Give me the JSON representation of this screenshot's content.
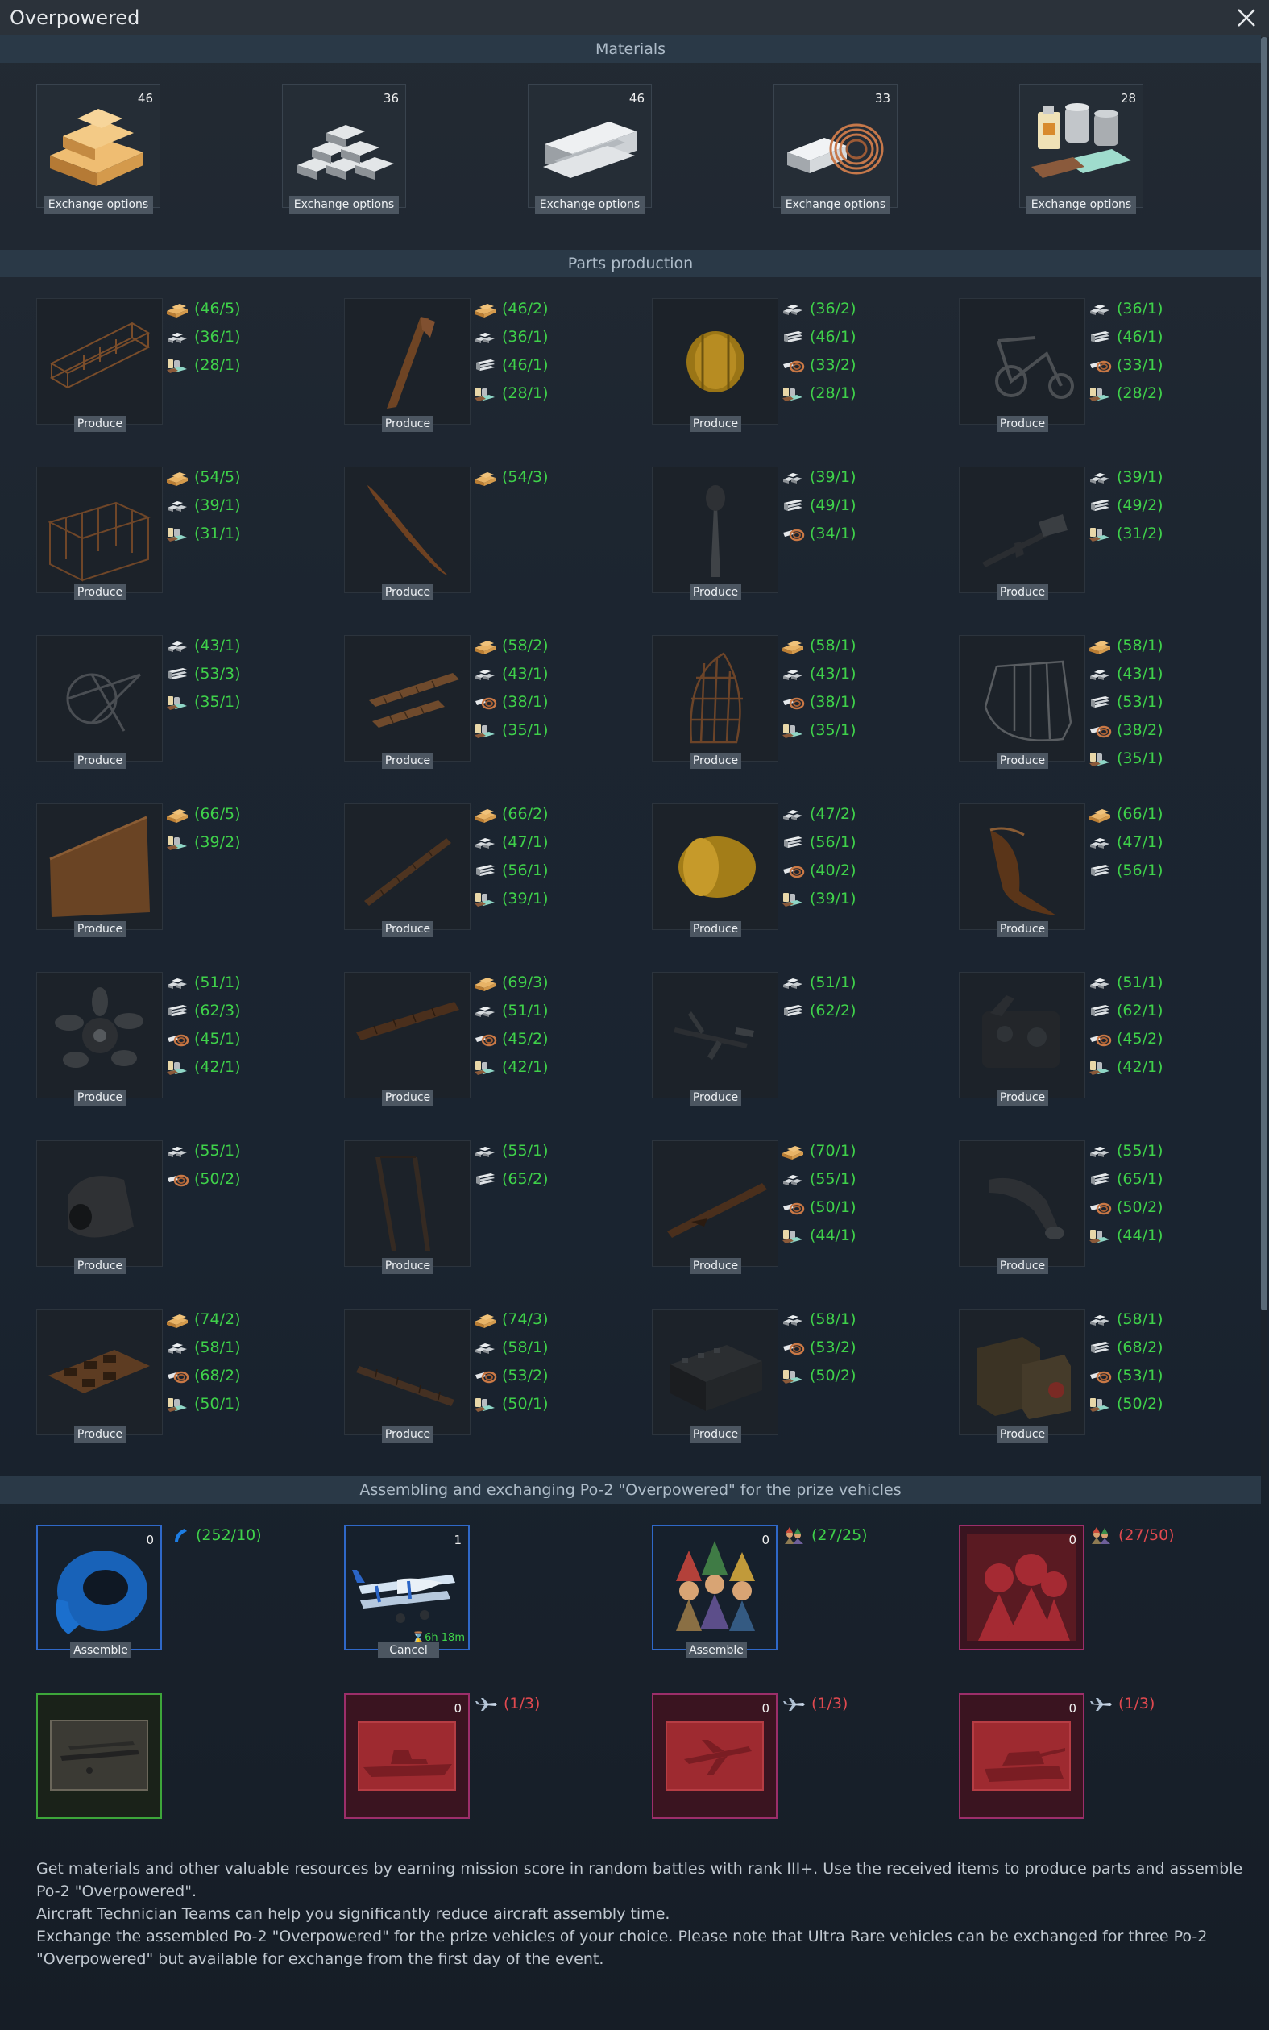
{
  "window": {
    "title": "Overpowered"
  },
  "sections": {
    "materials": "Materials",
    "parts": "Parts production",
    "assembly": "Assembling and exchanging Po-2 \"Overpowered\" for the prize vehicles"
  },
  "materials": [
    {
      "name": "wood",
      "count": "46",
      "button": "Exchange options"
    },
    {
      "name": "iron-ingots",
      "count": "36",
      "button": "Exchange options"
    },
    {
      "name": "steel-beams",
      "count": "46",
      "button": "Exchange options"
    },
    {
      "name": "aluminum-copper-wire",
      "count": "33",
      "button": "Exchange options"
    },
    {
      "name": "paints-glass",
      "count": "28",
      "button": "Exchange options"
    }
  ],
  "parts_button": "Produce",
  "parts": [
    {
      "icon": "fuselage-frame-icon",
      "reqs": [
        [
          "wood",
          "(46/5)"
        ],
        [
          "iron",
          "(36/1)"
        ],
        [
          "paint",
          "(28/1)"
        ]
      ]
    },
    {
      "icon": "strut-icon",
      "reqs": [
        [
          "wood",
          "(46/2)"
        ],
        [
          "iron",
          "(36/1)"
        ],
        [
          "steel",
          "(46/1)"
        ],
        [
          "paint",
          "(28/1)"
        ]
      ]
    },
    {
      "icon": "fuel-tank-icon",
      "reqs": [
        [
          "iron",
          "(36/2)"
        ],
        [
          "steel",
          "(46/1)"
        ],
        [
          "wire",
          "(33/2)"
        ],
        [
          "paint",
          "(28/1)"
        ]
      ]
    },
    {
      "icon": "landing-gear-icon",
      "reqs": [
        [
          "iron",
          "(36/1)"
        ],
        [
          "steel",
          "(46/1)"
        ],
        [
          "wire",
          "(33/1)"
        ],
        [
          "paint",
          "(28/2)"
        ]
      ]
    },
    {
      "icon": "cabin-frame-icon",
      "reqs": [
        [
          "wood",
          "(54/5)"
        ],
        [
          "iron",
          "(39/1)"
        ],
        [
          "paint",
          "(31/1)"
        ]
      ]
    },
    {
      "icon": "propeller-icon",
      "reqs": [
        [
          "wood",
          "(54/3)"
        ]
      ]
    },
    {
      "icon": "control-stick-icon",
      "reqs": [
        [
          "iron",
          "(39/1)"
        ],
        [
          "steel",
          "(49/1)"
        ],
        [
          "wire",
          "(34/1)"
        ]
      ]
    },
    {
      "icon": "machine-gun-icon",
      "reqs": [
        [
          "iron",
          "(39/1)"
        ],
        [
          "steel",
          "(49/2)"
        ],
        [
          "paint",
          "(31/2)"
        ]
      ]
    },
    {
      "icon": "mount-frame-icon",
      "reqs": [
        [
          "iron",
          "(43/1)"
        ],
        [
          "steel",
          "(53/3)"
        ],
        [
          "paint",
          "(35/1)"
        ]
      ]
    },
    {
      "icon": "wing-ribs-icon",
      "reqs": [
        [
          "wood",
          "(58/2)"
        ],
        [
          "iron",
          "(43/1)"
        ],
        [
          "wire",
          "(38/1)"
        ],
        [
          "paint",
          "(35/1)"
        ]
      ]
    },
    {
      "icon": "rudder-frame-icon",
      "reqs": [
        [
          "wood",
          "(58/1)"
        ],
        [
          "iron",
          "(43/1)"
        ],
        [
          "wire",
          "(38/1)"
        ],
        [
          "paint",
          "(35/1)"
        ]
      ]
    },
    {
      "icon": "seat-frame-icon",
      "reqs": [
        [
          "wood",
          "(58/1)"
        ],
        [
          "iron",
          "(43/1)"
        ],
        [
          "steel",
          "(53/1)"
        ],
        [
          "wire",
          "(38/2)"
        ],
        [
          "paint",
          "(35/1)"
        ]
      ]
    },
    {
      "icon": "wing-panel-icon",
      "reqs": [
        [
          "wood",
          "(66/5)"
        ],
        [
          "paint",
          "(39/2)"
        ]
      ]
    },
    {
      "icon": "wing-spar-icon",
      "reqs": [
        [
          "wood",
          "(66/2)"
        ],
        [
          "iron",
          "(47/1)"
        ],
        [
          "steel",
          "(56/1)"
        ],
        [
          "paint",
          "(39/1)"
        ]
      ]
    },
    {
      "icon": "tank-drum-icon",
      "reqs": [
        [
          "iron",
          "(47/2)"
        ],
        [
          "steel",
          "(56/1)"
        ],
        [
          "wire",
          "(40/2)"
        ],
        [
          "paint",
          "(39/1)"
        ]
      ]
    },
    {
      "icon": "exhaust-pipe-icon",
      "reqs": [
        [
          "wood",
          "(66/1)"
        ],
        [
          "iron",
          "(47/1)"
        ],
        [
          "steel",
          "(56/1)"
        ]
      ]
    },
    {
      "icon": "radial-engine-icon",
      "reqs": [
        [
          "iron",
          "(51/1)"
        ],
        [
          "steel",
          "(62/3)"
        ],
        [
          "wire",
          "(45/1)"
        ],
        [
          "paint",
          "(42/1)"
        ]
      ]
    },
    {
      "icon": "upper-wing-icon",
      "reqs": [
        [
          "wood",
          "(69/3)"
        ],
        [
          "iron",
          "(51/1)"
        ],
        [
          "wire",
          "(45/2)"
        ],
        [
          "paint",
          "(42/1)"
        ]
      ]
    },
    {
      "icon": "tail-assembly-icon",
      "reqs": [
        [
          "iron",
          "(51/1)"
        ],
        [
          "steel",
          "(62/2)"
        ]
      ]
    },
    {
      "icon": "instrument-panel-icon",
      "reqs": [
        [
          "iron",
          "(51/1)"
        ],
        [
          "steel",
          "(62/1)"
        ],
        [
          "wire",
          "(45/2)"
        ],
        [
          "paint",
          "(42/1)"
        ]
      ]
    },
    {
      "icon": "engine-cowling-icon",
      "reqs": [
        [
          "iron",
          "(55/1)"
        ],
        [
          "wire",
          "(50/2)"
        ]
      ]
    },
    {
      "icon": "wing-struts-icon",
      "reqs": [
        [
          "iron",
          "(55/1)"
        ],
        [
          "steel",
          "(65/2)"
        ]
      ]
    },
    {
      "icon": "lower-wing-icon",
      "reqs": [
        [
          "wood",
          "(70/1)"
        ],
        [
          "iron",
          "(55/1)"
        ],
        [
          "wire",
          "(50/1)"
        ],
        [
          "paint",
          "(44/1)"
        ]
      ]
    },
    {
      "icon": "intake-pipe-icon",
      "reqs": [
        [
          "iron",
          "(55/1)"
        ],
        [
          "steel",
          "(65/1)"
        ],
        [
          "wire",
          "(50/2)"
        ],
        [
          "paint",
          "(44/1)"
        ]
      ]
    },
    {
      "icon": "seat-box-icon",
      "reqs": [
        [
          "wood",
          "(74/2)"
        ],
        [
          "iron",
          "(58/1)"
        ],
        [
          "wire",
          "(68/2)"
        ],
        [
          "paint",
          "(50/1)"
        ]
      ]
    },
    {
      "icon": "elevator-icon",
      "reqs": [
        [
          "wood",
          "(74/3)"
        ],
        [
          "iron",
          "(58/1)"
        ],
        [
          "wire",
          "(53/2)"
        ],
        [
          "paint",
          "(50/1)"
        ]
      ]
    },
    {
      "icon": "battery-icon",
      "reqs": [
        [
          "iron",
          "(58/1)"
        ],
        [
          "wire",
          "(53/2)"
        ],
        [
          "paint",
          "(50/2)"
        ]
      ]
    },
    {
      "icon": "medkit-bag-icon",
      "reqs": [
        [
          "iron",
          "(58/1)"
        ],
        [
          "steel",
          "(68/2)"
        ],
        [
          "wire",
          "(53/1)"
        ],
        [
          "paint",
          "(50/2)"
        ]
      ]
    }
  ],
  "assembly": [
    {
      "kind": "tape",
      "frame": "blue",
      "count": "0",
      "button": "Assemble",
      "req_icon": "tape",
      "req": "(252/10)",
      "req_color": "green"
    },
    {
      "kind": "plane",
      "frame": "blue",
      "count": "1",
      "button": "Cancel",
      "timer": "6h 18m"
    },
    {
      "kind": "gnomes",
      "frame": "blue",
      "count": "0",
      "button": "Assemble",
      "req_icon": "team",
      "req": "(27/25)",
      "req_color": "green"
    },
    {
      "kind": "team-red",
      "frame": "pink",
      "count": "0",
      "req_icon": "team",
      "req": "(27/50)",
      "req_color": "red"
    },
    {
      "kind": "prize-plane",
      "frame": "green"
    },
    {
      "kind": "prize-ship",
      "frame": "pink",
      "count": "0",
      "req_icon": "plane",
      "req": "(1/3)",
      "req_color": "red"
    },
    {
      "kind": "prize-jet",
      "frame": "pink",
      "count": "0",
      "req_icon": "plane",
      "req": "(1/3)",
      "req_color": "red"
    },
    {
      "kind": "prize-tank",
      "frame": "pink",
      "count": "0",
      "req_icon": "plane",
      "req": "(1/3)",
      "req_color": "red"
    }
  ],
  "description": [
    "Get materials and other valuable resources by earning mission score in random battles with rank III+. Use the received items to produce parts and assemble Po-2 \"Overpowered\".",
    " Aircraft Technician Teams can help you significantly reduce aircraft assembly time.",
    "Exchange the assembled Po-2 \"Overpowered\" for the prize vehicles of your choice. Please note that Ultra Rare vehicles can be exchanged for three Po-2 \"Overpowered\" but available for exchange from the first day of the event."
  ],
  "colors": {
    "ok": "#3fd14a",
    "missing": "#e0494f",
    "header": "#2a3947"
  }
}
